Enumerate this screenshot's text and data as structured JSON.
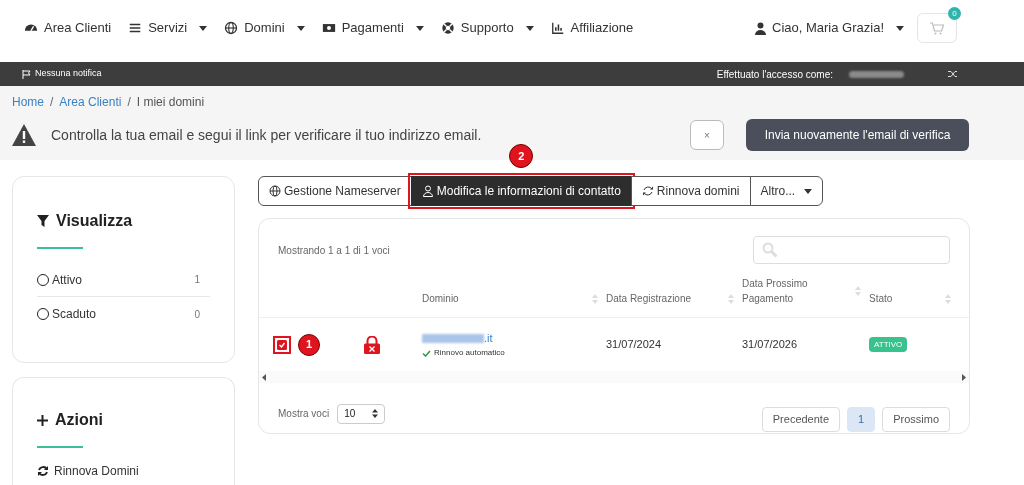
{
  "navbar": {
    "items": [
      {
        "label": "Area Clienti",
        "dropdown": false
      },
      {
        "label": "Servizi",
        "dropdown": true
      },
      {
        "label": "Domini",
        "dropdown": true
      },
      {
        "label": "Pagamenti",
        "dropdown": true
      },
      {
        "label": "Supporto",
        "dropdown": true
      },
      {
        "label": "Affiliazione",
        "dropdown": false
      }
    ],
    "user": "Ciao, Maria Grazia!",
    "cart_count": "0"
  },
  "status_bar": {
    "notifications": "Nessuna notifica",
    "logged_in_as": "Effettuato l'accesso come:"
  },
  "breadcrumb": [
    {
      "label": "Home",
      "link": true
    },
    {
      "separator": "/",
      "label": "Area Clienti",
      "link": true
    },
    {
      "separator": "/",
      "label": "I miei domini",
      "link": false
    }
  ],
  "alert": {
    "message": "Controlla la tua email e segui il link per verificare il tuo indirizzo email.",
    "close": "×",
    "button": "Invia nuovamente l'email di verifica"
  },
  "sidebar": {
    "filter": {
      "title": "Visualizza",
      "items": [
        {
          "label": "Attivo",
          "count": "1",
          "selected": false
        },
        {
          "label": "Scaduto",
          "count": "0",
          "selected": false
        }
      ]
    },
    "actions": {
      "title": "Azioni",
      "items": [
        "Rinnova Domini"
      ]
    }
  },
  "toolbar": [
    {
      "label": "Gestione Nameserver",
      "selected": false
    },
    {
      "label": "Modifica le informazioni di contatto",
      "selected": true,
      "annotation": "2"
    },
    {
      "label": "Rinnova domini",
      "selected": false
    },
    {
      "label": "Altro...",
      "selected": false
    }
  ],
  "table": {
    "info": "Mostrando 1 a 1 di 1 voci",
    "columns": [
      "Dominio",
      "Data Registrazione",
      "Data Prossimo Pagamento",
      "Stato"
    ],
    "rows": [
      {
        "checked": true,
        "annotation": "1",
        "locked": true,
        "domain": ".it",
        "auto_renew": "Rinnovo automatico",
        "registered": "31/07/2024",
        "next_payment": "31/07/2026",
        "status": "ATTIVO"
      }
    ],
    "page_size_label": "Mostra voci",
    "page_size": "10",
    "pagination": [
      {
        "label": "Precedente",
        "selected": false
      },
      {
        "label": "1",
        "selected": true
      },
      {
        "label": "Prossimo",
        "selected": false
      }
    ]
  }
}
